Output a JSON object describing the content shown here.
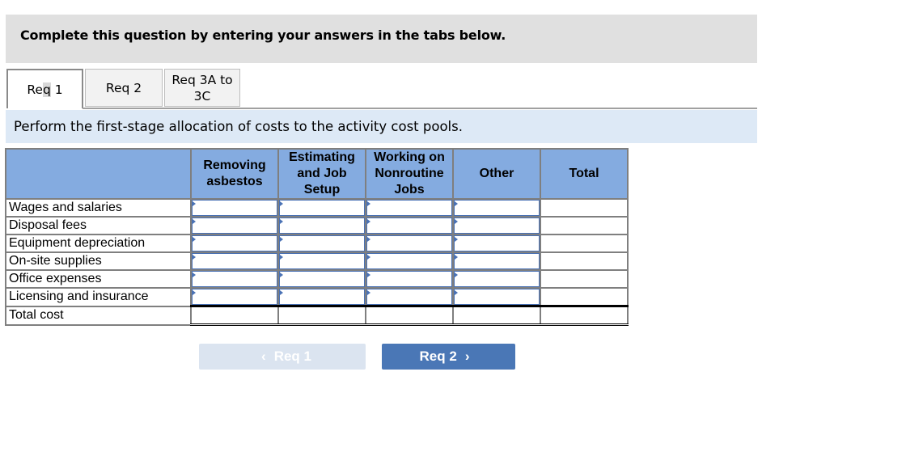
{
  "banner": {
    "text": "Complete this question by entering your answers in the tabs below."
  },
  "tabs": [
    {
      "label": "Req 1",
      "active": true
    },
    {
      "label": "Req 2",
      "active": false
    },
    {
      "label_line1": "Req 3A to",
      "label_line2": "3C",
      "active": false
    }
  ],
  "instruction": "Perform the first-stage allocation of costs to the activity cost pools.",
  "table": {
    "columns": [
      {
        "label_lines": [
          "Removing",
          "asbestos"
        ]
      },
      {
        "label_lines": [
          "Estimating",
          "and Job",
          "Setup"
        ]
      },
      {
        "label_lines": [
          "Working on",
          "Nonroutine",
          "Jobs"
        ]
      },
      {
        "label_lines": [
          "Other"
        ]
      },
      {
        "label_lines": [
          "Total"
        ]
      }
    ],
    "rows": [
      {
        "label": "Wages and salaries",
        "values": [
          "",
          "",
          "",
          "",
          ""
        ]
      },
      {
        "label": "Disposal fees",
        "values": [
          "",
          "",
          "",
          "",
          ""
        ]
      },
      {
        "label": "Equipment depreciation",
        "values": [
          "",
          "",
          "",
          "",
          ""
        ]
      },
      {
        "label": "On-site supplies",
        "values": [
          "",
          "",
          "",
          "",
          ""
        ]
      },
      {
        "label": "Office expenses",
        "values": [
          "",
          "",
          "",
          "",
          ""
        ]
      },
      {
        "label": "Licensing and insurance",
        "values": [
          "",
          "",
          "",
          "",
          ""
        ]
      }
    ],
    "total_row": {
      "label": "Total cost",
      "values": [
        "",
        "",
        "",
        "",
        ""
      ]
    }
  },
  "nav": {
    "prev_label": "Req 1",
    "prev_icon": "chevron-left-icon",
    "prev_glyph": "‹",
    "next_label": "Req 2",
    "next_icon": "chevron-right-icon",
    "next_glyph": "›"
  }
}
